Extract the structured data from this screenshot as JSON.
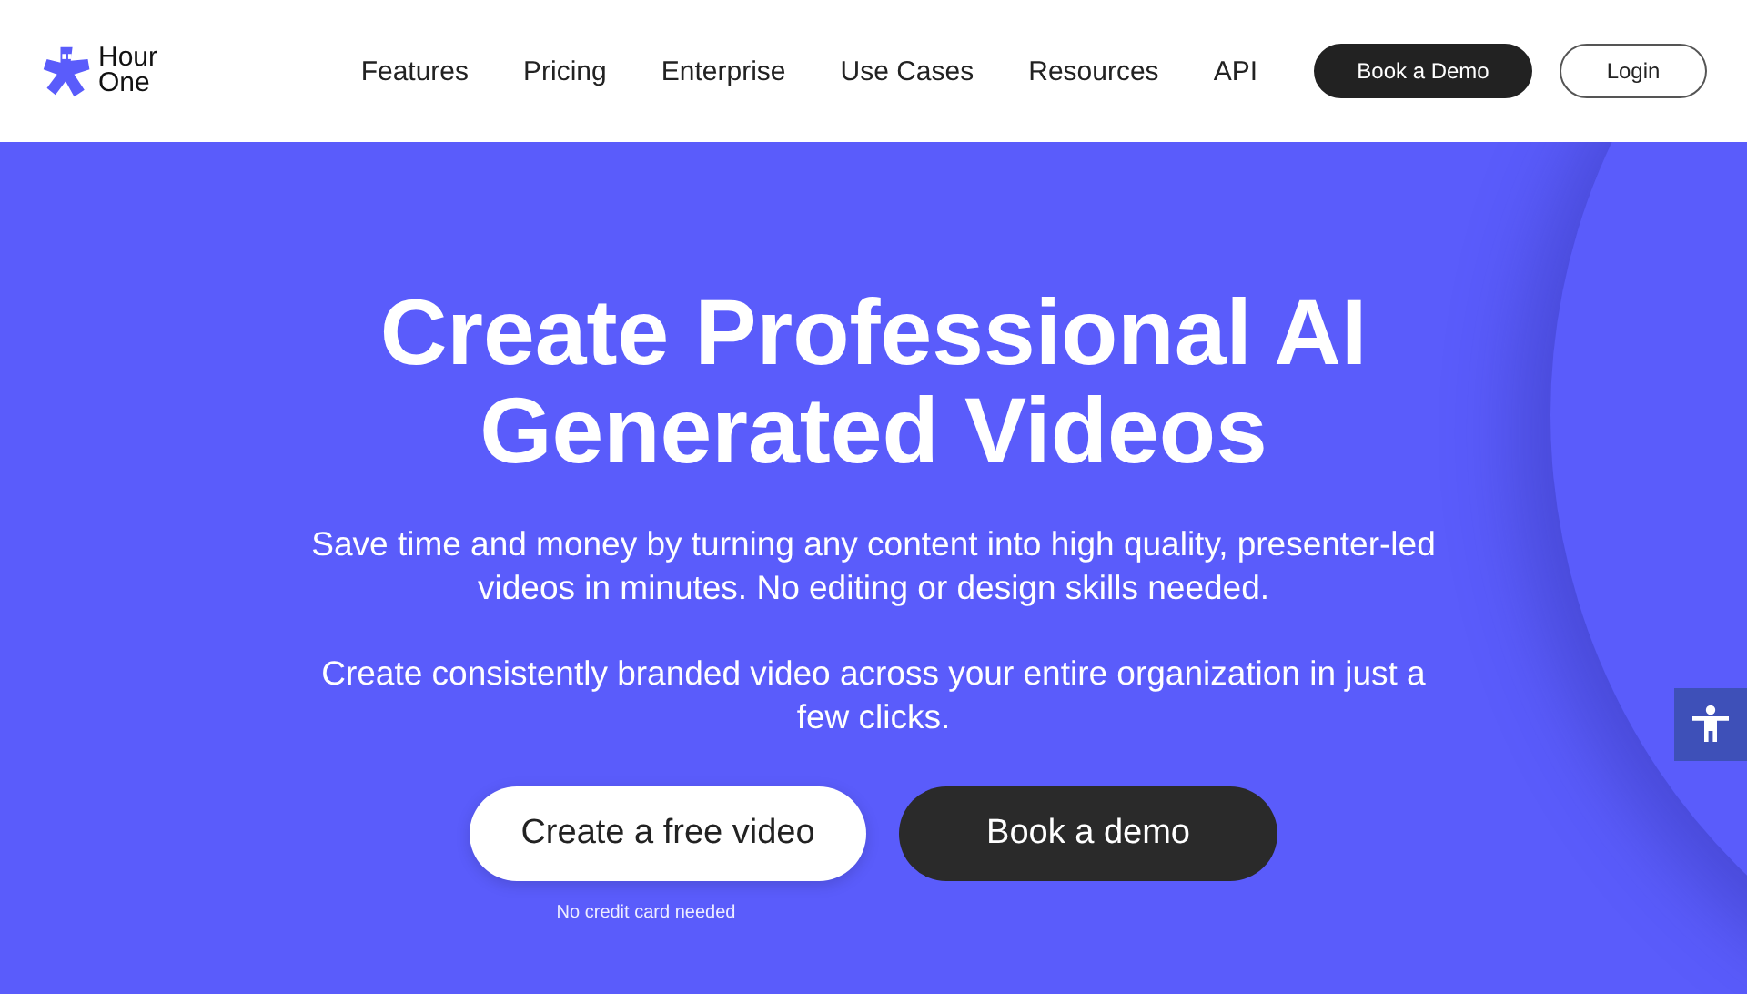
{
  "header": {
    "logo_text": "Hour One",
    "nav": [
      {
        "label": "Features"
      },
      {
        "label": "Pricing"
      },
      {
        "label": "Enterprise"
      },
      {
        "label": "Use Cases"
      },
      {
        "label": "Resources"
      },
      {
        "label": "API"
      }
    ],
    "buttons": [
      {
        "label": "Book a Demo",
        "kind": "dark"
      },
      {
        "label": "Login",
        "kind": "outline"
      }
    ]
  },
  "hero": {
    "title": "Create Professional AI Generated Videos",
    "paragraphs": [
      "Save time and money by turning any content into high quality, presenter-led videos in minutes. No editing or design skills needed.",
      "Create consistently branded video across your entire organization in just a few clicks."
    ],
    "buttons": [
      {
        "label": "Create a free video",
        "kind": "light"
      },
      {
        "label": "Book a demo",
        "kind": "dark"
      }
    ],
    "note": "No credit card needed"
  }
}
